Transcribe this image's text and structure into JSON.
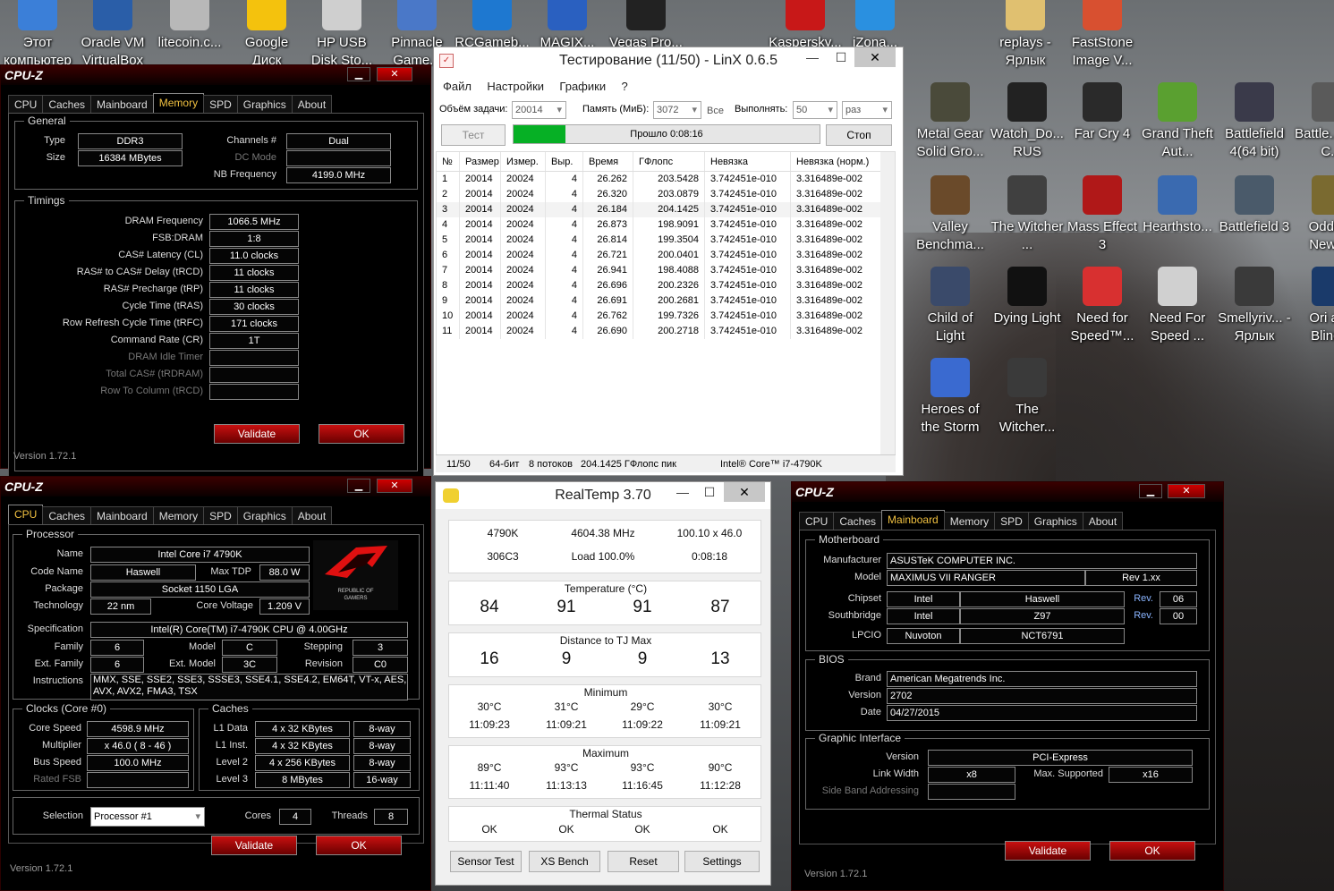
{
  "desktop": {
    "icons": [
      {
        "label": "Этот компьютер",
        "color": "#3b7fd8"
      },
      {
        "label": "Oracle VM VirtualBox",
        "color": "#2a5ea8"
      },
      {
        "label": "litecoin.c...",
        "color": "#b8b8b8"
      },
      {
        "label": "Google Диск",
        "color": "#f4c20d"
      },
      {
        "label": "HP USB Disk Sto...",
        "color": "#cfcfcf"
      },
      {
        "label": "Pinnacle Game...",
        "color": "#4a78c8"
      },
      {
        "label": "RCGameb...",
        "color": "#1e78d0"
      },
      {
        "label": "MAGIX...",
        "color": "#2a60c0"
      },
      {
        "label": "Vegas Pro...",
        "color": "#222222"
      },
      {
        "label": "Kaspersky...",
        "color": "#c81818"
      },
      {
        "label": "iZona...",
        "color": "#2a90e0"
      },
      {
        "label": "replays - Ярлык",
        "color": "#e0c070"
      },
      {
        "label": "FastStone Image V...",
        "color": "#d85030"
      },
      {
        "label": "Metal Gear Solid Gro...",
        "color": "#4a4a3a"
      },
      {
        "label": "Watch_Do... RUS",
        "color": "#222222"
      },
      {
        "label": "Far Cry 4",
        "color": "#2a2a2a"
      },
      {
        "label": "Grand Theft Aut...",
        "color": "#5aa030"
      },
      {
        "label": "Battlefield 4(64 bit)",
        "color": "#3a3a4a"
      },
      {
        "label": "Battle... Bad C...",
        "color": "#5a5a5a"
      },
      {
        "label": "Valley Benchma...",
        "color": "#6a4a2a"
      },
      {
        "label": "The Witcher ...",
        "color": "#404040"
      },
      {
        "label": "Mass Effect 3",
        "color": "#b01818"
      },
      {
        "label": "Hearthsto...",
        "color": "#3a6ab0"
      },
      {
        "label": "Battlefield 3",
        "color": "#4a5a6a"
      },
      {
        "label": "Oddw... New '...",
        "color": "#7a6a30"
      },
      {
        "label": "Child of Light",
        "color": "#3a4a6a"
      },
      {
        "label": "Dying Light",
        "color": "#111111"
      },
      {
        "label": "Need for Speed™...",
        "color": "#d83030"
      },
      {
        "label": "Need For Speed ...",
        "color": "#d0d0d0"
      },
      {
        "label": "Smellyriv... - Ярлык",
        "color": "#3a3a3a"
      },
      {
        "label": "Ori and Blind...",
        "color": "#1a3a6a"
      },
      {
        "label": "Heroes of the Storm",
        "color": "#3a6ad0"
      },
      {
        "label": "The Witcher...",
        "color": "#3a3a3a"
      }
    ]
  },
  "cpuz_memory": {
    "title": "CPU-Z",
    "tabs": [
      "CPU",
      "Caches",
      "Mainboard",
      "Memory",
      "SPD",
      "Graphics",
      "About"
    ],
    "active_tab": "Memory",
    "general_label": "General",
    "type_label": "Type",
    "type_value": "DDR3",
    "size_label": "Size",
    "size_value": "16384 MBytes",
    "channels_label": "Channels #",
    "channels_value": "Dual",
    "dcmode_label": "DC Mode",
    "nbfreq_label": "NB Frequency",
    "nbfreq_value": "4199.0 MHz",
    "timings_label": "Timings",
    "timings": [
      {
        "label": "DRAM Frequency",
        "value": "1066.5 MHz",
        "dim": false
      },
      {
        "label": "FSB:DRAM",
        "value": "1:8",
        "dim": false
      },
      {
        "label": "CAS# Latency (CL)",
        "value": "11.0 clocks",
        "dim": false
      },
      {
        "label": "RAS# to CAS# Delay (tRCD)",
        "value": "11 clocks",
        "dim": false
      },
      {
        "label": "RAS# Precharge (tRP)",
        "value": "11 clocks",
        "dim": false
      },
      {
        "label": "Cycle Time (tRAS)",
        "value": "30 clocks",
        "dim": false
      },
      {
        "label": "Row Refresh Cycle Time (tRFC)",
        "value": "171 clocks",
        "dim": false
      },
      {
        "label": "Command Rate (CR)",
        "value": "1T",
        "dim": false
      },
      {
        "label": "DRAM Idle Timer",
        "value": "",
        "dim": true
      },
      {
        "label": "Total CAS# (tRDRAM)",
        "value": "",
        "dim": true
      },
      {
        "label": "Row To Column (tRCD)",
        "value": "",
        "dim": true
      }
    ],
    "validate": "Validate",
    "ok": "OK",
    "version": "Version 1.72.1"
  },
  "cpuz_cpu": {
    "title": "CPU-Z",
    "tabs": [
      "CPU",
      "Caches",
      "Mainboard",
      "Memory",
      "SPD",
      "Graphics",
      "About"
    ],
    "active_tab": "CPU",
    "processor_label": "Processor",
    "name_label": "Name",
    "name_value": "Intel Core i7 4790K",
    "codename_label": "Code Name",
    "codename_value": "Haswell",
    "maxtdp_label": "Max TDP",
    "maxtdp_value": "88.0 W",
    "package_label": "Package",
    "package_value": "Socket 1150 LGA",
    "technology_label": "Technology",
    "technology_value": "22 nm",
    "corevoltage_label": "Core Voltage",
    "corevoltage_value": "1.209 V",
    "logo_text1": "REPUBLIC OF",
    "logo_text2": "GAMERS",
    "spec_label": "Specification",
    "spec_value": "Intel(R) Core(TM) i7-4790K CPU @ 4.00GHz",
    "family_label": "Family",
    "family_value": "6",
    "model_label": "Model",
    "model_value": "C",
    "stepping_label": "Stepping",
    "stepping_value": "3",
    "extfamily_label": "Ext. Family",
    "extfamily_value": "6",
    "extmodel_label": "Ext. Model",
    "extmodel_value": "3C",
    "revision_label": "Revision",
    "revision_value": "C0",
    "instructions_label": "Instructions",
    "instructions_line1": "MMX, SSE, SSE2, SSE3, SSSE3, SSE4.1, SSE4.2, EM64T, VT-x, AES,",
    "instructions_line2": "AVX, AVX2, FMA3, TSX",
    "clocks_label": "Clocks (Core #0)",
    "corespeed_label": "Core Speed",
    "corespeed_value": "4598.9 MHz",
    "multiplier_label": "Multiplier",
    "multiplier_value": "x 46.0 ( 8 - 46 )",
    "busspeed_label": "Bus Speed",
    "busspeed_value": "100.0 MHz",
    "ratedfsb_label": "Rated FSB",
    "caches_label": "Caches",
    "caches": [
      {
        "label": "L1 Data",
        "size": "4 x 32 KBytes",
        "way": "8-way"
      },
      {
        "label": "L1 Inst.",
        "size": "4 x 32 KBytes",
        "way": "8-way"
      },
      {
        "label": "Level 2",
        "size": "4 x 256 KBytes",
        "way": "8-way"
      },
      {
        "label": "Level 3",
        "size": "8 MBytes",
        "way": "16-way"
      }
    ],
    "selection_label": "Selection",
    "selection_value": "Processor #1",
    "cores_label": "Cores",
    "cores_value": "4",
    "threads_label": "Threads",
    "threads_value": "8",
    "validate": "Validate",
    "ok": "OK",
    "version": "Version 1.72.1"
  },
  "cpuz_mainboard": {
    "title": "CPU-Z",
    "tabs": [
      "CPU",
      "Caches",
      "Mainboard",
      "Memory",
      "SPD",
      "Graphics",
      "About"
    ],
    "active_tab": "Mainboard",
    "motherboard_label": "Motherboard",
    "manufacturer_label": "Manufacturer",
    "manufacturer_value": "ASUSTeK COMPUTER INC.",
    "model_label": "Model",
    "model_value": "MAXIMUS VII RANGER",
    "model_rev": "Rev 1.xx",
    "chipset_label": "Chipset",
    "chipset_vendor": "Intel",
    "chipset_name": "Haswell",
    "chipset_rev_label": "Rev.",
    "chipset_rev": "06",
    "southbridge_label": "Southbridge",
    "sb_vendor": "Intel",
    "sb_name": "Z97",
    "sb_rev_label": "Rev.",
    "sb_rev": "00",
    "lpcio_label": "LPCIO",
    "lpcio_vendor": "Nuvoton",
    "lpcio_name": "NCT6791",
    "bios_label": "BIOS",
    "brand_label": "Brand",
    "brand_value": "American Megatrends Inc.",
    "version_label": "Version",
    "version_value": "2702",
    "date_label": "Date",
    "date_value": "04/27/2015",
    "gi_label": "Graphic Interface",
    "giver_label": "Version",
    "giver_value": "PCI-Express",
    "linkwidth_label": "Link Width",
    "linkwidth_value": "x8",
    "maxsup_label": "Max. Supported",
    "maxsup_value": "x16",
    "sideband_label": "Side Band Addressing",
    "validate": "Validate",
    "ok": "OK",
    "version": "Version 1.72.1"
  },
  "linx": {
    "title": "Тестирование (11/50) - LinX 0.6.5",
    "menu": [
      "Файл",
      "Настройки",
      "Графики",
      "?"
    ],
    "size_label": "Объём задачи:",
    "size_value": "20014",
    "mem_label": "Память (МиБ):",
    "mem_value": "3072",
    "mem_all": "Все",
    "runs_label": "Выполнять:",
    "runs_value": "50",
    "runs_unit": "раз",
    "test_btn": "Тест",
    "progress_text": "Прошло 0:08:16",
    "progress_fraction": 0.17,
    "stop_btn": "Стоп",
    "columns": [
      "№",
      "Размер",
      "Измер.",
      "Выр.",
      "Время",
      "ГФлопс",
      "Невязка",
      "Невязка (норм.)"
    ],
    "rows": [
      [
        "1",
        "20014",
        "20024",
        "4",
        "26.262",
        "203.5428",
        "3.742451e-010",
        "3.316489e-002"
      ],
      [
        "2",
        "20014",
        "20024",
        "4",
        "26.320",
        "203.0879",
        "3.742451e-010",
        "3.316489e-002"
      ],
      [
        "3",
        "20014",
        "20024",
        "4",
        "26.184",
        "204.1425",
        "3.742451e-010",
        "3.316489e-002"
      ],
      [
        "4",
        "20014",
        "20024",
        "4",
        "26.873",
        "198.9091",
        "3.742451e-010",
        "3.316489e-002"
      ],
      [
        "5",
        "20014",
        "20024",
        "4",
        "26.814",
        "199.3504",
        "3.742451e-010",
        "3.316489e-002"
      ],
      [
        "6",
        "20014",
        "20024",
        "4",
        "26.721",
        "200.0401",
        "3.742451e-010",
        "3.316489e-002"
      ],
      [
        "7",
        "20014",
        "20024",
        "4",
        "26.941",
        "198.4088",
        "3.742451e-010",
        "3.316489e-002"
      ],
      [
        "8",
        "20014",
        "20024",
        "4",
        "26.696",
        "200.2326",
        "3.742451e-010",
        "3.316489e-002"
      ],
      [
        "9",
        "20014",
        "20024",
        "4",
        "26.691",
        "200.2681",
        "3.742451e-010",
        "3.316489e-002"
      ],
      [
        "10",
        "20014",
        "20024",
        "4",
        "26.762",
        "199.7326",
        "3.742451e-010",
        "3.316489e-002"
      ],
      [
        "11",
        "20014",
        "20024",
        "4",
        "26.690",
        "200.2718",
        "3.742451e-010",
        "3.316489e-002"
      ]
    ],
    "status": [
      "11/50",
      "64-бит",
      "8 потоков",
      "204.1425 ГФлопс пик",
      "Intel® Core™ i7-4790K"
    ]
  },
  "realtemp": {
    "title": "RealTemp 3.70",
    "cpu": "4790K",
    "freq": "4604.38 MHz",
    "mult": "100.10 x 46.0",
    "cpuid": "306C3",
    "load": "Load 100.0%",
    "elapsed": "0:08:18",
    "temp_label": "Temperature (°C)",
    "temps": [
      "84",
      "91",
      "91",
      "87"
    ],
    "dist_label": "Distance to TJ Max",
    "dists": [
      "16",
      "9",
      "9",
      "13"
    ],
    "min_label": "Minimum",
    "mins": [
      "30°C",
      "31°C",
      "29°C",
      "30°C"
    ],
    "min_times": [
      "11:09:23",
      "11:09:21",
      "11:09:22",
      "11:09:21"
    ],
    "max_label": "Maximum",
    "maxs": [
      "89°C",
      "93°C",
      "93°C",
      "90°C"
    ],
    "max_times": [
      "11:11:40",
      "11:13:13",
      "11:16:45",
      "11:12:28"
    ],
    "thermal_label": "Thermal Status",
    "thermal": [
      "OK",
      "OK",
      "OK",
      "OK"
    ],
    "buttons": [
      "Sensor Test",
      "XS Bench",
      "Reset",
      "Settings"
    ]
  }
}
